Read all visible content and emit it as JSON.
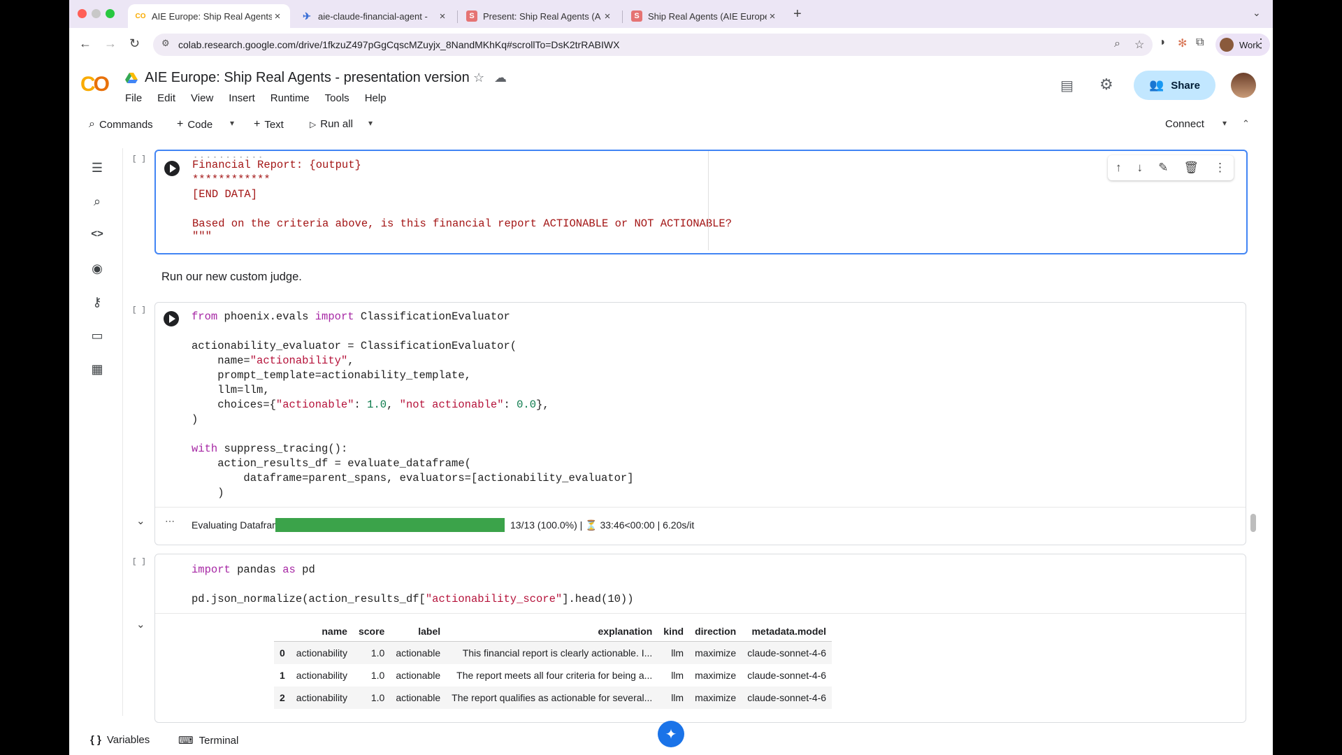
{
  "browser": {
    "tabs": [
      {
        "title": "AIE Europe: Ship Real Agents",
        "active": true,
        "favicon": "colab-icon"
      },
      {
        "title": "aie-claude-financial-agent - ",
        "active": false,
        "favicon": "arize-icon"
      },
      {
        "title": "Present: Ship Real Agents (A",
        "active": false,
        "favicon": "slides-icon"
      },
      {
        "title": "Ship Real Agents (AIE Europe",
        "active": false,
        "favicon": "slides-icon"
      }
    ],
    "url": "colab.research.google.com/drive/1fkzuZ497pGgCqscMZuyjx_8NandMKhKq#scrollTo=DsK2trRABIWX",
    "profile_label": "Work"
  },
  "header": {
    "title": "AIE Europe: Ship Real Agents - presentation version",
    "logo": "CO",
    "share_label": "Share",
    "menu": [
      "File",
      "Edit",
      "View",
      "Insert",
      "Runtime",
      "Tools",
      "Help"
    ]
  },
  "toolbar": {
    "commands_label": "Commands",
    "code_label": "Code",
    "text_label": "Text",
    "run_all_label": "Run all",
    "connect_label": "Connect"
  },
  "cells": {
    "cell1": {
      "bracket": "[ ]",
      "dots": "...........",
      "lines": [
        "Financial Report: {output}",
        "************",
        "[END DATA]",
        "",
        "Based on the criteria above, is this financial report ACTIONABLE or NOT ACTIONABLE?",
        "\"\"\""
      ]
    },
    "text_cell": "Run our new custom judge.",
    "cell2": {
      "bracket": "[ ]",
      "code": "from phoenix.evals import ClassificationEvaluator\n\nactionability_evaluator = ClassificationEvaluator(\n    name=\"actionability\",\n    prompt_template=actionability_template,\n    llm=llm,\n    choices={\"actionable\": 1.0, \"not actionable\": 0.0},\n)\n\nwith suppress_tracing():\n    action_results_df = evaluate_dataframe(\n        dataframe=parent_spans, evaluators=[actionability_evaluator]\n    )",
      "output": {
        "label": "Evaluating Dataframe",
        "progress_fraction": 1.0,
        "stats": "13/13 (100.0%) | ⏳ 33:46<00:00 | 6.20s/it"
      }
    },
    "cell3": {
      "bracket": "[ ]",
      "code": "import pandas as pd\n\npd.json_normalize(action_results_df[\"actionability_score\"].head(10))",
      "table": {
        "columns": [
          "",
          "name",
          "score",
          "label",
          "explanation",
          "kind",
          "direction",
          "metadata.model"
        ],
        "rows": [
          [
            "0",
            "actionability",
            "1.0",
            "actionable",
            "This financial report is clearly actionable. I...",
            "llm",
            "maximize",
            "claude-sonnet-4-6"
          ],
          [
            "1",
            "actionability",
            "1.0",
            "actionable",
            "The report meets all four criteria for being a...",
            "llm",
            "maximize",
            "claude-sonnet-4-6"
          ],
          [
            "2",
            "actionability",
            "1.0",
            "actionable",
            "The report qualifies as actionable for several...",
            "llm",
            "maximize",
            "claude-sonnet-4-6"
          ]
        ]
      }
    }
  },
  "bottom": {
    "variables_label": "Variables",
    "terminal_label": "Terminal"
  }
}
